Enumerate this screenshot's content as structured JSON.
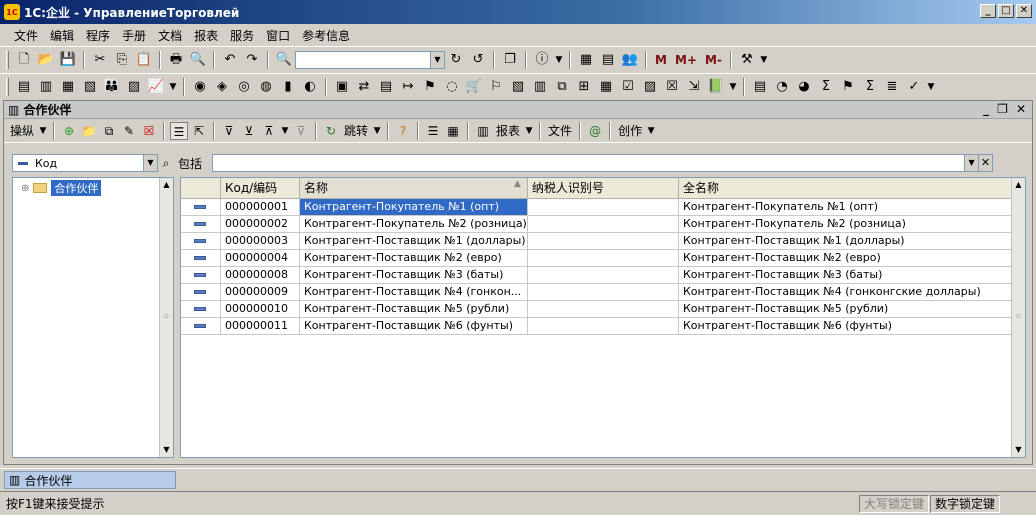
{
  "window": {
    "logo": "1C",
    "title": "1С:企业 - УправлениеТорговлей",
    "controls": [
      "_",
      "□",
      "✕"
    ]
  },
  "menu": [
    "文件",
    "编辑",
    "程序",
    "手册",
    "文档",
    "报表",
    "服务",
    "窗口",
    "参考信息"
  ],
  "toolbar_extra": {
    "m": "M",
    "m_plus": "M+",
    "m_minus": "M-"
  },
  "form": {
    "title": "合作伙伴",
    "toolbar": {
      "actions": "操纵",
      "go": "跳转",
      "reports": "报表",
      "file": "文件",
      "create": "创作"
    },
    "filter": {
      "field": "Код",
      "condition": "包括",
      "value": ""
    }
  },
  "tree": {
    "root": "合作伙伴"
  },
  "grid": {
    "columns": [
      "",
      "Код/编码",
      "名称",
      "纳税人识别号",
      "全名称"
    ],
    "sorted_column": 2,
    "selected_row": 0,
    "rows": [
      {
        "code": "000000001",
        "name": "Контрагент-Покупатель №1 (опт)",
        "inn": "",
        "full": "Контрагент-Покупатель №1 (опт)"
      },
      {
        "code": "000000002",
        "name": "Контрагент-Покупатель №2 (розница)",
        "inn": "",
        "full": "Контрагент-Покупатель №2 (розница)"
      },
      {
        "code": "000000003",
        "name": "Контрагент-Поставщик №1 (доллары)",
        "inn": "",
        "full": "Контрагент-Поставщик №1 (доллары)"
      },
      {
        "code": "000000004",
        "name": "Контрагент-Поставщик №2 (евро)",
        "inn": "",
        "full": "Контрагент-Поставщик №2 (евро)"
      },
      {
        "code": "000000008",
        "name": "Контрагент-Поставщик №3 (баты)",
        "inn": "",
        "full": "Контрагент-Поставщик №3 (баты)"
      },
      {
        "code": "000000009",
        "name": "Контрагент-Поставщик №4 (гонкон...",
        "inn": "",
        "full": "Контрагент-Поставщик №4 (гонконгские доллары)"
      },
      {
        "code": "000000010",
        "name": "Контрагент-Поставщик №5 (рубли)",
        "inn": "",
        "full": "Контрагент-Поставщик №5 (рубли)"
      },
      {
        "code": "000000011",
        "name": "Контрагент-Поставщик №6 (фунты)",
        "inn": "",
        "full": "Контрагент-Поставщик №6 (фунты)"
      }
    ]
  },
  "taskbar": {
    "tab": "合作伙伴"
  },
  "status": {
    "hint": "按F1键来接受提示",
    "caps": "大写锁定键",
    "num": "数字锁定键"
  },
  "colors": {
    "selection": "#316ac5",
    "title_gradient_start": "#0a246a",
    "face": "#d4d0c8"
  }
}
